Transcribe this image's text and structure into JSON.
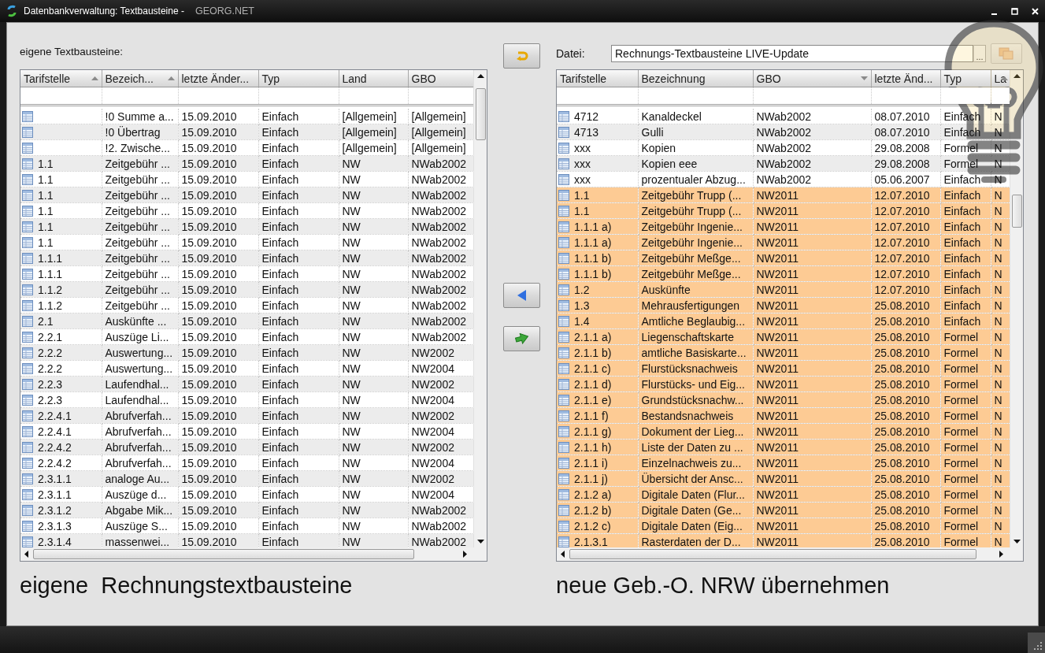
{
  "window": {
    "title": "Datenbankverwaltung: Textbausteine -",
    "subtitle": "GEORG.NET"
  },
  "left_panel": {
    "label": "eigene Textbausteine:",
    "table": {
      "columns": [
        {
          "label": "Tarifstelle",
          "sorted_ascending": true,
          "sorted_descending": false
        },
        {
          "label": "Bezeich...",
          "sorted_ascending": true,
          "sorted_descending": false
        },
        {
          "label": "letzte Änder...",
          "sorted_ascending": false,
          "sorted_descending": false
        },
        {
          "label": "Typ",
          "sorted_ascending": false,
          "sorted_descending": false
        },
        {
          "label": "Land",
          "sorted_ascending": false,
          "sorted_descending": false
        },
        {
          "label": "GBO",
          "sorted_ascending": false,
          "sorted_descending": false
        }
      ],
      "rows": [
        {
          "cells": [
            null,
            "!0 Summe a...",
            "15.09.2010",
            "Einfach",
            "[Allgemein]",
            "[Allgemein]"
          ]
        },
        {
          "cells": [
            null,
            "!0 Übertrag",
            "15.09.2010",
            "Einfach",
            "[Allgemein]",
            "[Allgemein]"
          ]
        },
        {
          "cells": [
            null,
            "!2. Zwische...",
            "15.09.2010",
            "Einfach",
            "[Allgemein]",
            "[Allgemein]"
          ]
        },
        {
          "cells": [
            "1.1",
            "Zeitgebühr ...",
            "15.09.2010",
            "Einfach",
            "NW",
            "NWab2002"
          ]
        },
        {
          "cells": [
            "1.1",
            "Zeitgebühr ...",
            "15.09.2010",
            "Einfach",
            "NW",
            "NWab2002"
          ]
        },
        {
          "cells": [
            "1.1",
            "Zeitgebühr ...",
            "15.09.2010",
            "Einfach",
            "NW",
            "NWab2002"
          ]
        },
        {
          "cells": [
            "1.1",
            "Zeitgebühr ...",
            "15.09.2010",
            "Einfach",
            "NW",
            "NWab2002"
          ]
        },
        {
          "cells": [
            "1.1",
            "Zeitgebühr ...",
            "15.09.2010",
            "Einfach",
            "NW",
            "NWab2002"
          ]
        },
        {
          "cells": [
            "1.1",
            "Zeitgebühr ...",
            "15.09.2010",
            "Einfach",
            "NW",
            "NWab2002"
          ]
        },
        {
          "cells": [
            "1.1.1",
            "Zeitgebühr ...",
            "15.09.2010",
            "Einfach",
            "NW",
            "NWab2002"
          ]
        },
        {
          "cells": [
            "1.1.1",
            "Zeitgebühr ...",
            "15.09.2010",
            "Einfach",
            "NW",
            "NWab2002"
          ]
        },
        {
          "cells": [
            "1.1.2",
            "Zeitgebühr ...",
            "15.09.2010",
            "Einfach",
            "NW",
            "NWab2002"
          ]
        },
        {
          "cells": [
            "1.1.2",
            "Zeitgebühr ...",
            "15.09.2010",
            "Einfach",
            "NW",
            "NWab2002"
          ]
        },
        {
          "cells": [
            "2.1",
            "Auskünfte ...",
            "15.09.2010",
            "Einfach",
            "NW",
            "NWab2002"
          ]
        },
        {
          "cells": [
            "2.2.1",
            "Auszüge Li...",
            "15.09.2010",
            "Einfach",
            "NW",
            "NWab2002"
          ]
        },
        {
          "cells": [
            "2.2.2",
            "Auswertung...",
            "15.09.2010",
            "Einfach",
            "NW",
            "NW2002"
          ]
        },
        {
          "cells": [
            "2.2.2",
            "Auswertung...",
            "15.09.2010",
            "Einfach",
            "NW",
            "NW2004"
          ]
        },
        {
          "cells": [
            "2.2.3",
            "Laufendhal...",
            "15.09.2010",
            "Einfach",
            "NW",
            "NW2002"
          ]
        },
        {
          "cells": [
            "2.2.3",
            "Laufendhal...",
            "15.09.2010",
            "Einfach",
            "NW",
            "NW2004"
          ]
        },
        {
          "cells": [
            "2.2.4.1",
            "Abrufverfah...",
            "15.09.2010",
            "Einfach",
            "NW",
            "NW2002"
          ]
        },
        {
          "cells": [
            "2.2.4.1",
            "Abrufverfah...",
            "15.09.2010",
            "Einfach",
            "NW",
            "NW2004"
          ]
        },
        {
          "cells": [
            "2.2.4.2",
            "Abrufverfah...",
            "15.09.2010",
            "Einfach",
            "NW",
            "NW2002"
          ]
        },
        {
          "cells": [
            "2.2.4.2",
            "Abrufverfah...",
            "15.09.2010",
            "Einfach",
            "NW",
            "NW2004"
          ]
        },
        {
          "cells": [
            "2.3.1.1",
            "analoge Au...",
            "15.09.2010",
            "Einfach",
            "NW",
            "NW2002"
          ]
        },
        {
          "cells": [
            "2.3.1.1",
            "Auszüge d...",
            "15.09.2010",
            "Einfach",
            "NW",
            "NW2004"
          ]
        },
        {
          "cells": [
            "2.3.1.2",
            "Abgabe Mik...",
            "15.09.2010",
            "Einfach",
            "NW",
            "NWab2002"
          ]
        },
        {
          "cells": [
            "2.3.1.3",
            "Auszüge S...",
            "15.09.2010",
            "Einfach",
            "NW",
            "NWab2002"
          ]
        },
        {
          "cells": [
            "2.3.1.4",
            "massenwei...",
            "15.09.2010",
            "Einfach",
            "NW",
            "NWab2002"
          ]
        }
      ]
    },
    "caption": "eigene  Rechnungstextbausteine"
  },
  "middle_buttons": [
    {
      "kind": "undo"
    },
    {
      "kind": "move-left"
    },
    {
      "kind": "transfer"
    }
  ],
  "right_panel": {
    "file_label": "Datei:",
    "file_value": "Rechnungs-Textbausteine LIVE-Update",
    "browse_button": "...",
    "load_button": {
      "disabled": true
    },
    "table": {
      "columns": [
        {
          "label": "Tarifstelle",
          "sorted_ascending": false,
          "sorted_descending": false
        },
        {
          "label": "Bezeichnung",
          "sorted_ascending": false,
          "sorted_descending": false
        },
        {
          "label": "GBO",
          "sorted_ascending": false,
          "sorted_descending": true
        },
        {
          "label": "letzte Änd...",
          "sorted_ascending": false,
          "sorted_descending": false
        },
        {
          "label": "Typ",
          "sorted_ascending": false,
          "sorted_descending": false
        },
        {
          "label": "La",
          "sorted_ascending": true,
          "sorted_descending": false
        }
      ],
      "rows": [
        {
          "highlighted": false,
          "cells": [
            "4712",
            "Kanaldeckel",
            "NWab2002",
            "08.07.2010",
            "Einfach",
            "N"
          ]
        },
        {
          "highlighted": false,
          "cells": [
            "4713",
            "Gulli",
            "NWab2002",
            "08.07.2010",
            "Einfach",
            "N"
          ]
        },
        {
          "highlighted": false,
          "cells": [
            "xxx",
            "Kopien",
            "NWab2002",
            "29.08.2008",
            "Formel",
            "N"
          ]
        },
        {
          "highlighted": false,
          "cells": [
            "xxx",
            "Kopien  eee",
            "NWab2002",
            "29.08.2008",
            "Formel",
            "N"
          ]
        },
        {
          "highlighted": false,
          "cells": [
            "xxx",
            "prozentualer Abzug...",
            "NWab2002",
            "05.06.2007",
            "Einfach",
            "N"
          ]
        },
        {
          "highlighted": true,
          "cells": [
            "1.1",
            "Zeitgebühr Trupp (...",
            "NW2011",
            "12.07.2010",
            "Einfach",
            "N"
          ]
        },
        {
          "highlighted": true,
          "cells": [
            "1.1",
            "Zeitgebühr Trupp (...",
            "NW2011",
            "12.07.2010",
            "Einfach",
            "N"
          ]
        },
        {
          "highlighted": true,
          "cells": [
            "1.1.1 a)",
            "Zeitgebühr Ingenie...",
            "NW2011",
            "12.07.2010",
            "Einfach",
            "N"
          ]
        },
        {
          "highlighted": true,
          "cells": [
            "1.1.1 a)",
            "Zeitgebühr Ingenie...",
            "NW2011",
            "12.07.2010",
            "Einfach",
            "N"
          ]
        },
        {
          "highlighted": true,
          "cells": [
            "1.1.1 b)",
            "Zeitgebühr Meßge...",
            "NW2011",
            "12.07.2010",
            "Einfach",
            "N"
          ]
        },
        {
          "highlighted": true,
          "cells": [
            "1.1.1 b)",
            "Zeitgebühr Meßge...",
            "NW2011",
            "12.07.2010",
            "Einfach",
            "N"
          ]
        },
        {
          "highlighted": true,
          "cells": [
            "1.2",
            "Auskünfte",
            "NW2011",
            "12.07.2010",
            "Einfach",
            "N"
          ]
        },
        {
          "highlighted": true,
          "cells": [
            "1.3",
            "Mehrausfertigungen",
            "NW2011",
            "25.08.2010",
            "Einfach",
            "N"
          ]
        },
        {
          "highlighted": true,
          "cells": [
            "1.4",
            "Amtliche Beglaubig...",
            "NW2011",
            "25.08.2010",
            "Einfach",
            "N"
          ]
        },
        {
          "highlighted": true,
          "cells": [
            "2.1.1 a)",
            "Liegenschaftskarte",
            "NW2011",
            "25.08.2010",
            "Formel",
            "N"
          ]
        },
        {
          "highlighted": true,
          "cells": [
            "2.1.1 b)",
            "amtliche Basiskarte...",
            "NW2011",
            "25.08.2010",
            "Formel",
            "N"
          ]
        },
        {
          "highlighted": true,
          "cells": [
            "2.1.1 c)",
            "Flurstücksnachweis",
            "NW2011",
            "25.08.2010",
            "Formel",
            "N"
          ]
        },
        {
          "highlighted": true,
          "cells": [
            "2.1.1 d)",
            "Flurstücks- und Eig...",
            "NW2011",
            "25.08.2010",
            "Formel",
            "N"
          ]
        },
        {
          "highlighted": true,
          "cells": [
            "2.1.1 e)",
            "Grundstücksnachw...",
            "NW2011",
            "25.08.2010",
            "Formel",
            "N"
          ]
        },
        {
          "highlighted": true,
          "cells": [
            "2.1.1 f)",
            "Bestandsnachweis",
            "NW2011",
            "25.08.2010",
            "Formel",
            "N"
          ]
        },
        {
          "highlighted": true,
          "cells": [
            "2.1.1 g)",
            "Dokument der Lieg...",
            "NW2011",
            "25.08.2010",
            "Formel",
            "N"
          ]
        },
        {
          "highlighted": true,
          "cells": [
            "2.1.1 h)",
            "Liste der Daten zu ...",
            "NW2011",
            "25.08.2010",
            "Formel",
            "N"
          ]
        },
        {
          "highlighted": true,
          "cells": [
            "2.1.1 i)",
            "Einzelnachweis zu...",
            "NW2011",
            "25.08.2010",
            "Formel",
            "N"
          ]
        },
        {
          "highlighted": true,
          "cells": [
            "2.1.1 j)",
            "Übersicht der Ansc...",
            "NW2011",
            "25.08.2010",
            "Formel",
            "N"
          ]
        },
        {
          "highlighted": true,
          "cells": [
            "2.1.2 a)",
            "Digitale Daten (Flur...",
            "NW2011",
            "25.08.2010",
            "Formel",
            "N"
          ]
        },
        {
          "highlighted": true,
          "cells": [
            "2.1.2 b)",
            "Digitale Daten (Ge...",
            "NW2011",
            "25.08.2010",
            "Formel",
            "N"
          ]
        },
        {
          "highlighted": true,
          "cells": [
            "2.1.2 c)",
            "Digitale Daten (Eig...",
            "NW2011",
            "25.08.2010",
            "Formel",
            "N"
          ]
        },
        {
          "highlighted": true,
          "cells": [
            "2.1.3.1",
            "Rasterdaten der D...",
            "NW2011",
            "25.08.2010",
            "Formel",
            "N"
          ]
        }
      ]
    },
    "caption": "neue Geb.-O. NRW übernehmen"
  }
}
